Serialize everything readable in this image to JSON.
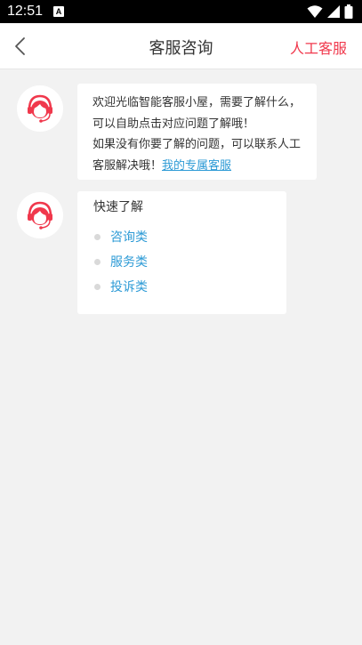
{
  "status_bar": {
    "time": "12:51",
    "notification_badge": "A"
  },
  "navbar": {
    "title": "客服咨询",
    "action_label": "人工客服",
    "action_color": "#f0384c"
  },
  "messages": {
    "welcome": {
      "lines": [
        "欢迎光临智能客服小屋，需要了解什么，",
        "可以自助点击对应问题了解哦！",
        "如果没有你要了解的问题，可以联系人工",
        "客服解决哦！"
      ],
      "link_text": "我的专属客服"
    },
    "quick": {
      "title": "快速了解",
      "items": [
        {
          "label": "咨询类"
        },
        {
          "label": "服务类"
        },
        {
          "label": "投诉类"
        }
      ]
    }
  },
  "colors": {
    "accent": "#f0384c",
    "link": "#2e9bd6"
  }
}
